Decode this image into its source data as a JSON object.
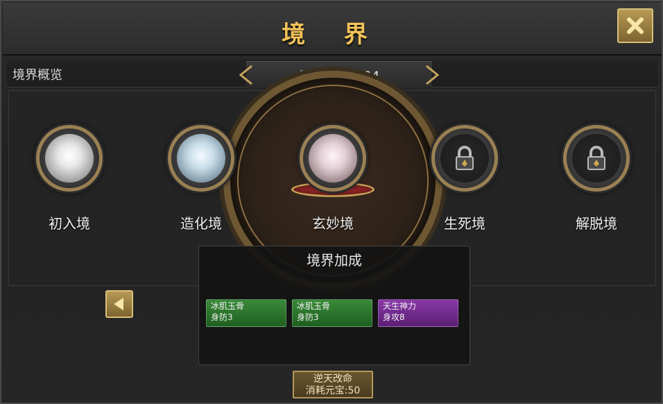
{
  "window": {
    "title": "境 界"
  },
  "header": {
    "overview_label": "境界概览",
    "yuanqi_label": "元气:",
    "yuanqi_value": "145.84"
  },
  "realms": [
    {
      "name": "初入境",
      "orb": "white",
      "locked": false
    },
    {
      "name": "造化境",
      "orb": "blue",
      "locked": false
    },
    {
      "name": "玄妙境",
      "orb": "pink",
      "locked": false,
      "current": true
    },
    {
      "name": "生死境",
      "orb": "locked",
      "locked": true
    },
    {
      "name": "解脱境",
      "orb": "locked",
      "locked": true
    }
  ],
  "bonus": {
    "title": "境界加成",
    "cards": [
      {
        "name": "冰肌玉骨",
        "stat": "身防3",
        "color": "#2f7a2f"
      },
      {
        "name": "冰肌玉骨",
        "stat": "身防3",
        "color": "#2f7a2f"
      },
      {
        "name": "天生神力",
        "stat": "身攻8",
        "color": "#7a2f9a"
      }
    ]
  },
  "action_button": {
    "line1": "逆天改命",
    "line2": "消耗元宝:50"
  },
  "icons": {
    "close": "close-icon",
    "prev": "chevron-left-icon",
    "lock": "lock-icon"
  },
  "colors": {
    "title_gold": "#f2c25a",
    "button_gold": "#b79a55"
  }
}
